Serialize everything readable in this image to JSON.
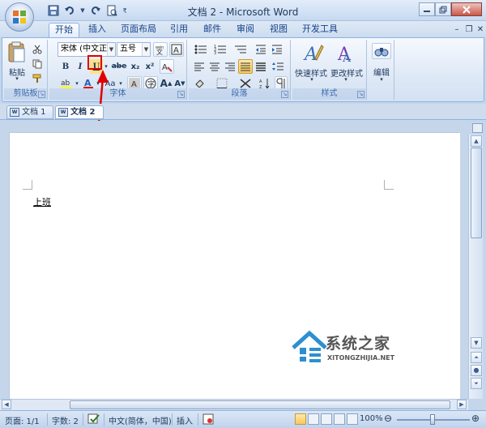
{
  "window": {
    "title": "文档 2 - Microsoft Word"
  },
  "tabs": [
    {
      "label": "开始",
      "active": true
    },
    {
      "label": "插入"
    },
    {
      "label": "页面布局"
    },
    {
      "label": "引用"
    },
    {
      "label": "邮件"
    },
    {
      "label": "审阅"
    },
    {
      "label": "视图"
    },
    {
      "label": "开发工具"
    }
  ],
  "ribbon": {
    "clipboard": {
      "label": "剪贴板",
      "paste_label": "粘贴"
    },
    "font": {
      "label": "字体",
      "font_name": "宋体 (中文正文)",
      "font_size": "五号",
      "bold": "B",
      "italic": "I",
      "underline": "U",
      "strike": "abe",
      "subscript": "x₂",
      "superscript": "x²",
      "change_case": "Aa",
      "grow": "A",
      "shrink": "A"
    },
    "paragraph": {
      "label": "段落"
    },
    "styles": {
      "label": "样式",
      "quick_styles": "快速样式",
      "change_styles": "更改样式"
    },
    "editing": {
      "label": "编辑"
    }
  },
  "doc_tabs": [
    {
      "label": "文档 1"
    },
    {
      "label": "文档 2",
      "active": true
    }
  ],
  "document": {
    "text": "上班"
  },
  "watermark": {
    "title": "系统之家",
    "url": "XITONGZHIJIA.NET"
  },
  "statusbar": {
    "page": "页面: 1/1",
    "words": "字数: 2",
    "language": "中文(简体，中国)",
    "mode": "插入",
    "zoom": "100%"
  },
  "colors": {
    "accent": "#15428b",
    "annotation": "#e00000"
  }
}
